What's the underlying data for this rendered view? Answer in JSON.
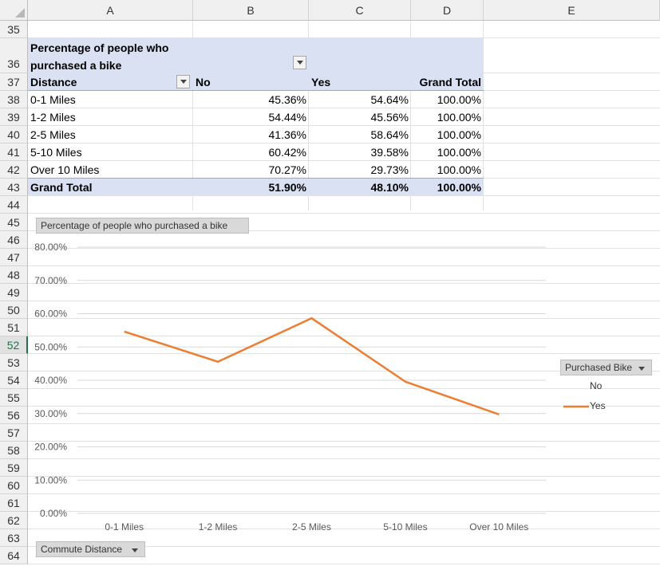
{
  "columns": [
    "A",
    "B",
    "C",
    "D",
    "E"
  ],
  "rows": [
    "35",
    "36",
    "37",
    "38",
    "39",
    "40",
    "41",
    "42",
    "43",
    "44",
    "45",
    "46",
    "47",
    "48",
    "49",
    "50",
    "51",
    "52",
    "53",
    "54",
    "55",
    "56",
    "57",
    "58",
    "59",
    "60",
    "61",
    "62",
    "63",
    "64"
  ],
  "active_row": "52",
  "pivot": {
    "title": "Percentage of people who purchased a bike",
    "row_field": "Distance",
    "col_headers": [
      "No",
      "Yes",
      "Grand Total"
    ],
    "rows": [
      {
        "label": "0-1 Miles",
        "no": "45.36%",
        "yes": "54.64%",
        "total": "100.00%"
      },
      {
        "label": "1-2 Miles",
        "no": "54.44%",
        "yes": "45.56%",
        "total": "100.00%"
      },
      {
        "label": "2-5 Miles",
        "no": "41.36%",
        "yes": "58.64%",
        "total": "100.00%"
      },
      {
        "label": "5-10 Miles",
        "no": "60.42%",
        "yes": "39.58%",
        "total": "100.00%"
      },
      {
        "label": "Over 10 Miles",
        "no": "70.27%",
        "yes": "29.73%",
        "total": "100.00%"
      }
    ],
    "grand_total": {
      "label": "Grand Total",
      "no": "51.90%",
      "yes": "48.10%",
      "total": "100.00%"
    }
  },
  "chart_buttons": {
    "title": "Percentage of people who purchased a bike",
    "axis_field": "Commute Distance",
    "legend_field": "Purchased Bike"
  },
  "colors": {
    "series_yes": "#ed7d31",
    "pivot_band": "#d9e1f2",
    "gridline": "#d9d9d9"
  },
  "chart_data": {
    "type": "line",
    "categories": [
      "0-1 Miles",
      "1-2 Miles",
      "2-5 Miles",
      "5-10 Miles",
      "Over 10 Miles"
    ],
    "series": [
      {
        "name": "No",
        "values": [],
        "visible": false
      },
      {
        "name": "Yes",
        "values": [
          54.64,
          45.56,
          58.64,
          39.58,
          29.73
        ],
        "color": "#ed7d31"
      }
    ],
    "y_ticks": [
      "0.00%",
      "10.00%",
      "20.00%",
      "30.00%",
      "40.00%",
      "50.00%",
      "60.00%",
      "70.00%",
      "80.00%"
    ],
    "ylim": [
      0,
      80
    ],
    "grid": true,
    "legend_position": "right"
  }
}
